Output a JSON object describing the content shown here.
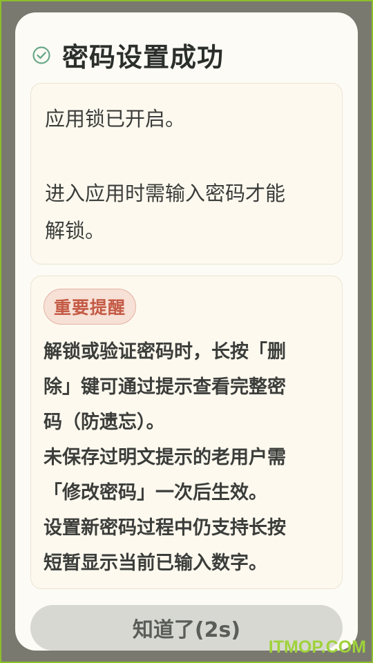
{
  "dialog": {
    "title": "密码设置成功",
    "icon": "check-circle-icon",
    "accent_color": "#6aa88a"
  },
  "info": {
    "line1": "应用锁已开启。",
    "line2": "进入应用时需输入密码才能",
    "line3": "解锁。"
  },
  "tip": {
    "badge": "重要提醒",
    "lines": [
      "解锁或验证密码时，长按「删",
      "除」键可通过提示查看完整密",
      "码（防遗忘）。",
      "未保存过明文提示的老用户需",
      "「修改密码」一次后生效。",
      "设置新密码过程中仍支持长按",
      "短暂显示当前已输入数字。"
    ]
  },
  "button": {
    "label": "知道了(2s)"
  },
  "watermark": {
    "text": "ITMOP.COM"
  }
}
